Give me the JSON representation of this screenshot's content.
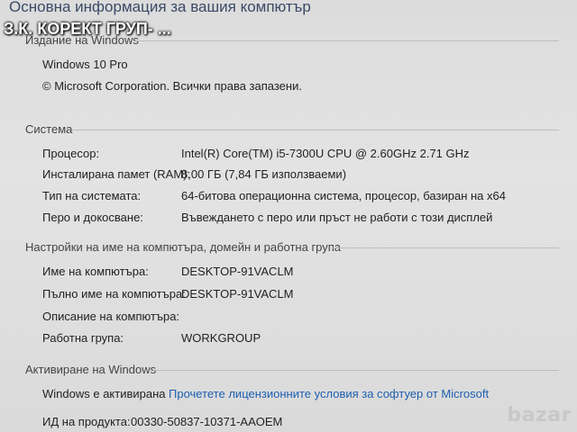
{
  "page": {
    "heading": "Основна информация за вашия компютър",
    "overlay_title": "З.К. КОРЕКТ ГРУП- ..."
  },
  "edition": {
    "header": "Издание на Windows",
    "name": "Windows 10 Pro",
    "copyright": "© Microsoft Corporation. Всички права запазени."
  },
  "system": {
    "header": "Система",
    "rows": [
      {
        "label": "Процесор:",
        "value": "Intel(R) Core(TM) i5-7300U CPU @ 2.60GHz   2.71 GHz"
      },
      {
        "label": "Инсталирана памет (RAM):",
        "value": "8,00 ГБ (7,84 ГБ използваеми)"
      },
      {
        "label": "Тип на системата:",
        "value": "64-битова операционна система, процесор, базиран на x64"
      },
      {
        "label": "Перо и докосване:",
        "value": "Въвеждането с перо или пръст не работи с този дисплей"
      }
    ]
  },
  "computer_name": {
    "header": "Настройки на име на компютъра, домейн и работна група",
    "rows": [
      {
        "label": "Име на компютъра:",
        "value": "DESKTOP-91VACLM"
      },
      {
        "label": "Пълно име на компютъра:",
        "value": "DESKTOP-91VACLM"
      },
      {
        "label": "Описание на компютъра:",
        "value": ""
      },
      {
        "label": "Работна група:",
        "value": "WORKGROUP"
      }
    ]
  },
  "activation": {
    "header": "Активиране на Windows",
    "status": "Windows е активирана",
    "license_link": "Прочетете лицензионните условия за софтуер от Microsoft",
    "product_id_label": "ИД на продукта:",
    "product_id": "00330-50837-10371-AAOEM"
  },
  "watermark": "bazar"
}
